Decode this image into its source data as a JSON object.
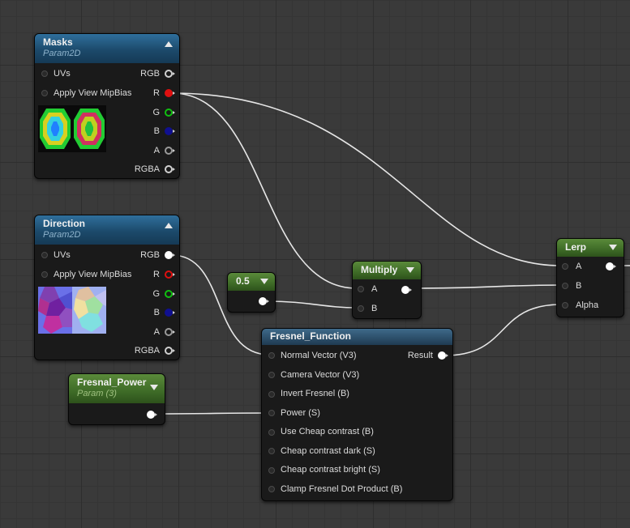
{
  "colors": {
    "pin_red": "#e01010",
    "pin_green": "#10c010",
    "pin_blue": "#101090",
    "wire": "#e6e6e6"
  },
  "masks": {
    "title": "Masks",
    "subtitle": "Param2D",
    "inputs": [
      "UVs",
      "Apply View MipBias"
    ],
    "outputs": [
      "RGB",
      "R",
      "G",
      "B",
      "A",
      "RGBA"
    ]
  },
  "direction": {
    "title": "Direction",
    "subtitle": "Param2D",
    "inputs": [
      "UVs",
      "Apply View MipBias"
    ],
    "outputs": [
      "RGB",
      "R",
      "G",
      "B",
      "A",
      "RGBA"
    ]
  },
  "const_node": {
    "title": "0.5"
  },
  "multiply": {
    "title": "Multiply",
    "inputs": [
      "A",
      "B"
    ]
  },
  "lerp": {
    "title": "Lerp",
    "inputs": [
      "A",
      "B",
      "Alpha"
    ]
  },
  "fresnel_power": {
    "title": "Fresnal_Power",
    "subtitle": "Param (3)"
  },
  "fresnel_function": {
    "title": "Fresnel_Function",
    "output": "Result",
    "inputs": [
      "Normal Vector (V3)",
      "Camera Vector (V3)",
      "Invert Fresnel (B)",
      "Power (S)",
      "Use Cheap contrast (B)",
      "Cheap contrast dark (S)",
      "Cheap contrast bright (S)",
      "Clamp Fresnel Dot Product (B)"
    ]
  }
}
